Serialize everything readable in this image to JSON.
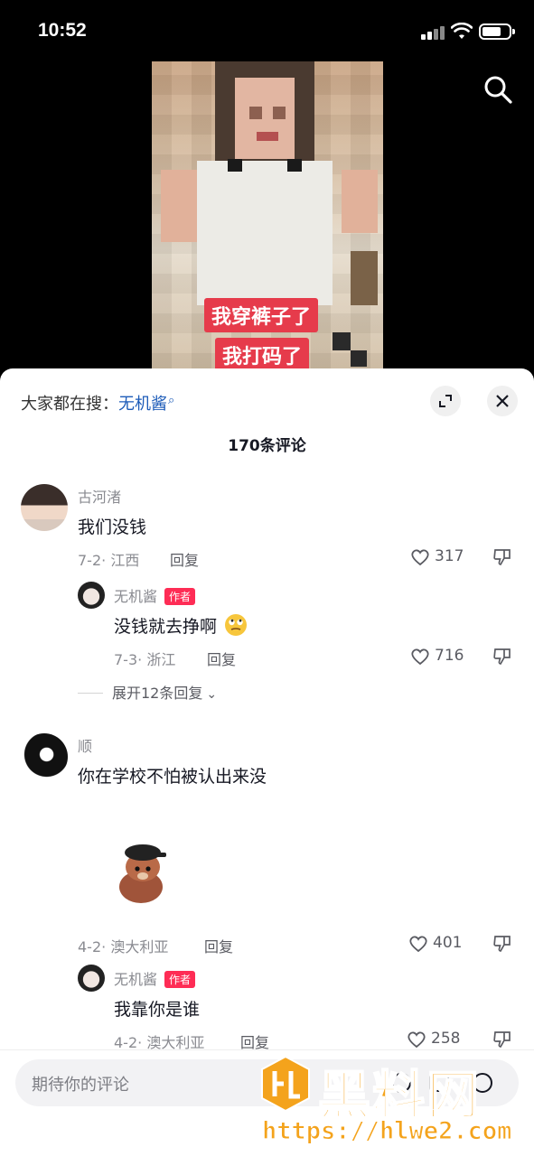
{
  "status_bar": {
    "time": "10:52"
  },
  "video": {
    "captions": [
      "我穿裤子了",
      "我打码了"
    ]
  },
  "comments_panel": {
    "hot_search_prefix": "大家都在搜：",
    "hot_search_keyword": "无机酱",
    "comment_count_label": "170条评论",
    "expand_replies_label": "展开12条回复",
    "reply_label": "回复",
    "author_tag": "作者"
  },
  "comments": [
    {
      "user": "古河渚",
      "text": "我们没钱",
      "date": "7-2",
      "location": "江西",
      "likes": "317"
    },
    {
      "user": "无机酱",
      "text": "没钱就去挣啊",
      "date": "7-3",
      "location": "浙江",
      "likes": "716"
    },
    {
      "user": "顺",
      "text": "你在学校不怕被认出来没",
      "date": "4-2",
      "location": "澳大利亚",
      "likes": "401"
    },
    {
      "user": "无机酱",
      "text": "我靠你是谁",
      "date": "4-2",
      "location": "澳大利亚",
      "likes": "258"
    }
  ],
  "input": {
    "placeholder": "期待你的评论"
  },
  "watermark": {
    "title": "黑料网",
    "url": "https://hlwe2.com"
  },
  "colors": {
    "accent_red": "#fe2c55",
    "link_blue": "#1c5bb8",
    "watermark_orange": "#f4a31c"
  }
}
